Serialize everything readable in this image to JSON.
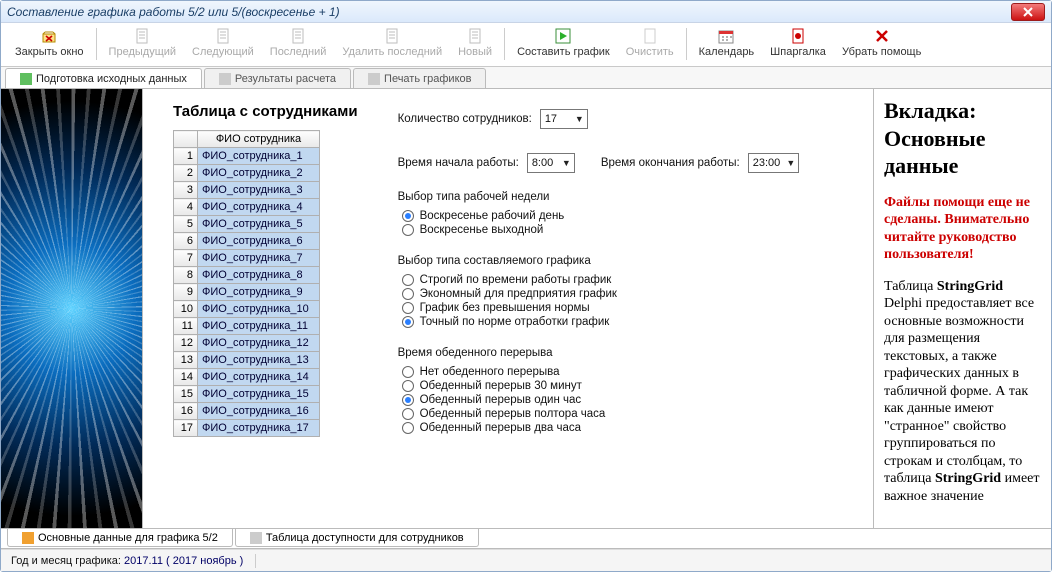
{
  "window_title": "Составление графика работы 5/2 или 5/(воскресенье + 1)",
  "toolbar": [
    {
      "label": "Закрыть окно",
      "enabled": true,
      "icon": "close"
    },
    "sep",
    {
      "label": "Предыдущий",
      "enabled": false,
      "icon": "page"
    },
    {
      "label": "Следующий",
      "enabled": false,
      "icon": "page"
    },
    {
      "label": "Последний",
      "enabled": false,
      "icon": "page"
    },
    {
      "label": "Удалить последний",
      "enabled": false,
      "icon": "page"
    },
    {
      "label": "Новый",
      "enabled": false,
      "icon": "page"
    },
    "sep",
    {
      "label": "Составить график",
      "enabled": true,
      "icon": "play"
    },
    {
      "label": "Очистить",
      "enabled": false,
      "icon": "blank"
    },
    "sep",
    {
      "label": "Календарь",
      "enabled": true,
      "icon": "cal"
    },
    {
      "label": "Шпаргалка",
      "enabled": true,
      "icon": "pdf"
    },
    {
      "label": "Убрать помощь",
      "enabled": true,
      "icon": "x"
    }
  ],
  "top_tabs": [
    {
      "label": "Подготовка исходных данных",
      "active": true,
      "icon": "green"
    },
    {
      "label": "Результаты расчета",
      "active": false,
      "icon": "gray"
    },
    {
      "label": "Печать графиков",
      "active": false,
      "icon": "gray"
    }
  ],
  "table_heading": "Таблица с сотрудниками",
  "table_header": "ФИО сотрудника",
  "table_rows": [
    "ФИО_сотрудника_1",
    "ФИО_сотрудника_2",
    "ФИО_сотрудника_3",
    "ФИО_сотрудника_4",
    "ФИО_сотрудника_5",
    "ФИО_сотрудника_6",
    "ФИО_сотрудника_7",
    "ФИО_сотрудника_8",
    "ФИО_сотрудника_9",
    "ФИО_сотрудника_10",
    "ФИО_сотрудника_11",
    "ФИО_сотрудника_12",
    "ФИО_сотрудника_13",
    "ФИО_сотрудника_14",
    "ФИО_сотрудника_15",
    "ФИО_сотрудника_16",
    "ФИО_сотрудника_17"
  ],
  "fields": {
    "emp_count_label": "Количество сотрудников:",
    "emp_count_value": "17",
    "start_label": "Время начала работы:",
    "start_value": "8:00",
    "end_label": "Время окончания работы:",
    "end_value": "23:00"
  },
  "group_week": {
    "title": "Выбор типа рабочей недели",
    "options": [
      {
        "label": "Воскресенье рабочий день",
        "checked": true
      },
      {
        "label": "Воскресенье выходной",
        "checked": false
      }
    ]
  },
  "group_schedule": {
    "title": "Выбор типа составляемого графика",
    "options": [
      {
        "label": "Строгий по времени работы график",
        "checked": false
      },
      {
        "label": "Экономный для предприятия график",
        "checked": false
      },
      {
        "label": "График без превышения нормы",
        "checked": false
      },
      {
        "label": "Точный по норме отработки график",
        "checked": true
      }
    ]
  },
  "group_lunch": {
    "title": "Время обеденного перерыва",
    "options": [
      {
        "label": "Нет обеденного перерыва",
        "checked": false
      },
      {
        "label": "Обеденный перерыв 30 минут",
        "checked": false
      },
      {
        "label": "Обеденный перерыв один час",
        "checked": true
      },
      {
        "label": "Обеденный перерыв полтора часа",
        "checked": false
      },
      {
        "label": "Обеденный перерыв два часа",
        "checked": false
      }
    ]
  },
  "help": {
    "heading": "Вкладка: Основные данные",
    "warning": "Файлы помощи еще не сделаны. Внимательно читайте руководство пользователя!",
    "body_parts": [
      "Таблица ",
      " Delphi предоставляет все основные возможности для размещения текстовых, а также графических данных в табличной форме. А так как данные имеют \"странное\" свойство группироваться по строкам и столбцам, то таблица ",
      " имеет важное значение"
    ],
    "bold": "StringGrid"
  },
  "bottom_tabs": [
    {
      "label": "Основные данные для графика 5/2",
      "icon": "orange"
    },
    {
      "label": "Таблица доступности для сотрудников",
      "icon": "gray"
    }
  ],
  "status": {
    "label": "Год и месяц графика:",
    "value": "2017.11  ( 2017  ноябрь )"
  }
}
